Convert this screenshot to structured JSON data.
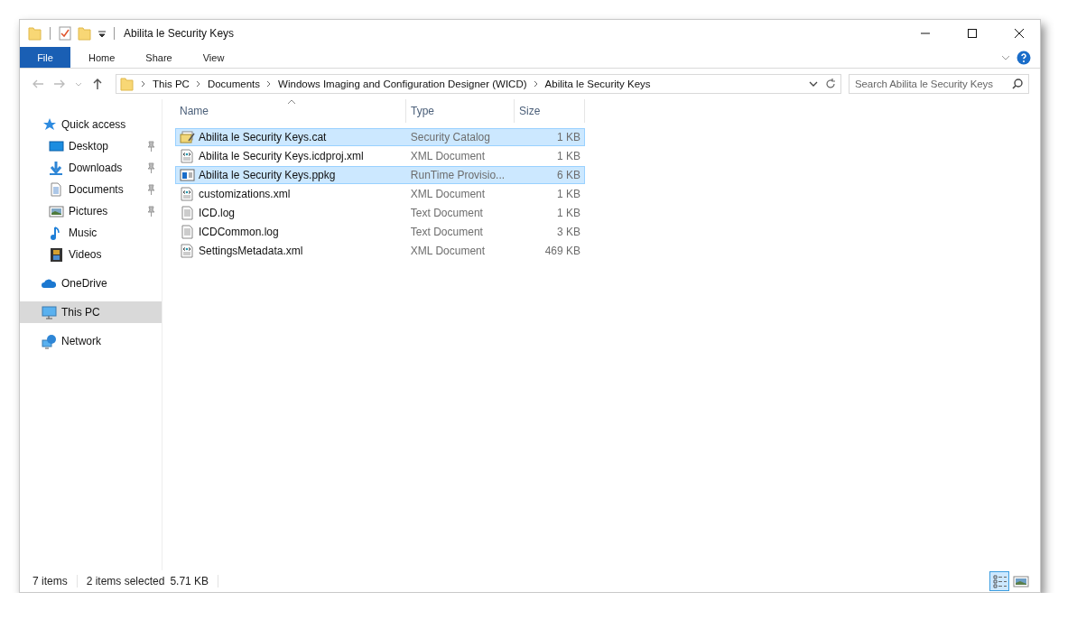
{
  "window": {
    "title": "Abilita le Security Keys"
  },
  "ribbon_tabs": [
    {
      "label": "File",
      "kind": "file"
    },
    {
      "label": "Home",
      "kind": "tab"
    },
    {
      "label": "Share",
      "kind": "tab"
    },
    {
      "label": "View",
      "kind": "tab"
    }
  ],
  "address": {
    "crumbs": [
      "This PC",
      "Documents",
      "Windows Imaging and Configuration Designer (WICD)",
      "Abilita le Security Keys"
    ]
  },
  "search": {
    "placeholder": "Search Abilita le Security Keys"
  },
  "sidebar": {
    "sections": [
      {
        "label": "Quick access",
        "kind": "star",
        "selected": false,
        "children": [
          {
            "label": "Desktop",
            "kind": "desktop",
            "pinned": true,
            "selected": false
          },
          {
            "label": "Downloads",
            "kind": "download",
            "pinned": true,
            "selected": false
          },
          {
            "label": "Documents",
            "kind": "document",
            "pinned": true,
            "selected": false
          },
          {
            "label": "Pictures",
            "kind": "pictures",
            "pinned": true,
            "selected": false
          },
          {
            "label": "Music",
            "kind": "music",
            "pinned": false,
            "selected": false
          },
          {
            "label": "Videos",
            "kind": "videos",
            "pinned": false,
            "selected": false
          }
        ]
      },
      {
        "label": "OneDrive",
        "kind": "cloud",
        "selected": false
      },
      {
        "label": "This PC",
        "kind": "pc",
        "selected": true
      },
      {
        "label": "Network",
        "kind": "network",
        "selected": false
      }
    ]
  },
  "table": {
    "columns": [
      {
        "label": "Name",
        "sorted": true
      },
      {
        "label": "Type",
        "sorted": false
      },
      {
        "label": "Size",
        "sorted": false
      }
    ],
    "rows": [
      {
        "name": "Abilita le Security Keys.cat",
        "type": "Security Catalog",
        "size": "1 KB",
        "kind": "cat",
        "selected": true
      },
      {
        "name": "Abilita le Security Keys.icdproj.xml",
        "type": "XML Document",
        "size": "1 KB",
        "kind": "xml",
        "selected": false
      },
      {
        "name": "Abilita le Security Keys.ppkg",
        "type": "RunTime Provisio...",
        "size": "6 KB",
        "kind": "ppkg",
        "selected": true
      },
      {
        "name": "customizations.xml",
        "type": "XML Document",
        "size": "1 KB",
        "kind": "xml",
        "selected": false
      },
      {
        "name": "ICD.log",
        "type": "Text Document",
        "size": "1 KB",
        "kind": "text",
        "selected": false
      },
      {
        "name": "ICDCommon.log",
        "type": "Text Document",
        "size": "3 KB",
        "kind": "text",
        "selected": false
      },
      {
        "name": "SettingsMetadata.xml",
        "type": "XML Document",
        "size": "469 KB",
        "kind": "xml",
        "selected": false
      }
    ]
  },
  "status_bar": {
    "count": "7 items",
    "selection": "2 items selected",
    "selection_size": "5.71 KB"
  },
  "view_buttons": [
    {
      "kind": "details",
      "selected": true
    },
    {
      "kind": "large",
      "selected": false
    }
  ]
}
